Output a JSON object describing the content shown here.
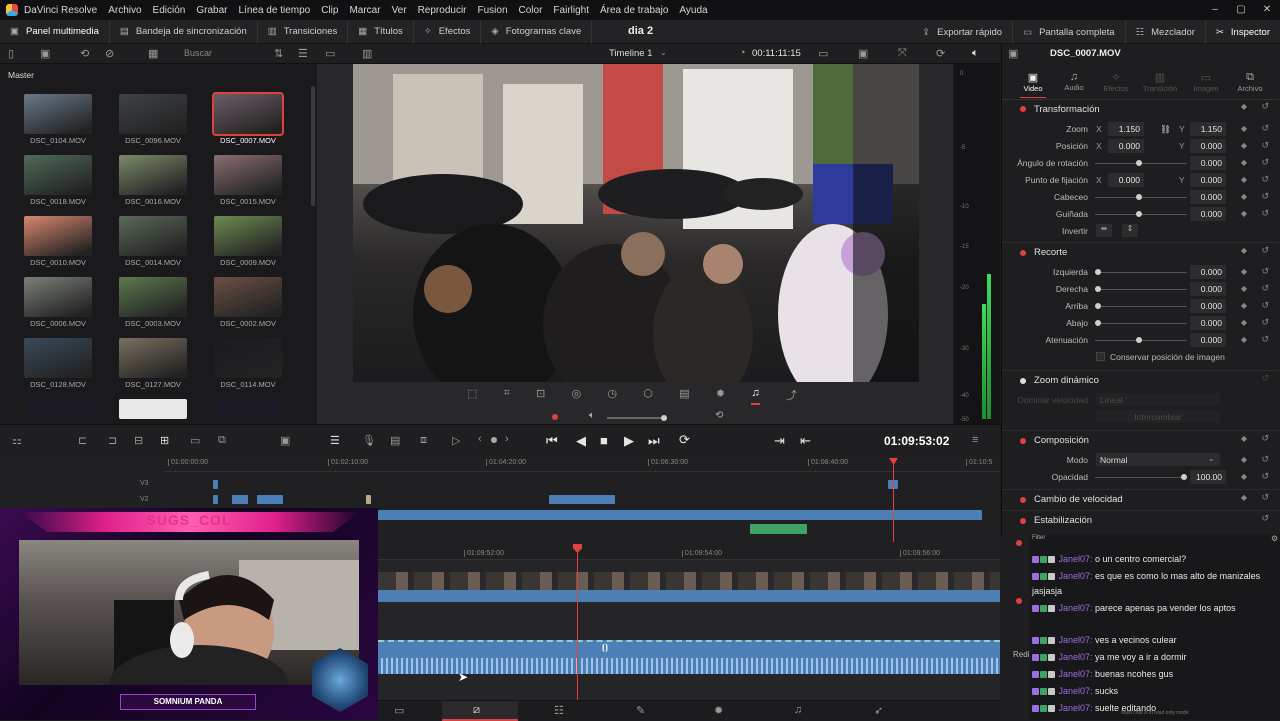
{
  "menu": {
    "app": "DaVinci Resolve",
    "items": [
      "Archivo",
      "Edición",
      "Grabar",
      "Línea de tiempo",
      "Clip",
      "Marcar",
      "Ver",
      "Reproducir",
      "Fusion",
      "Color",
      "Fairlight",
      "Área de trabajo",
      "Ayuda"
    ]
  },
  "toolbar": {
    "panel_media": "Panel multimedia",
    "sync_bin": "Bandeja de sincronización",
    "transitions": "Transiciones",
    "titles": "Títulos",
    "effects": "Efectos",
    "keyframes": "Fotogramas clave",
    "project_name": "dia 2",
    "quick_export": "Exportar rápido",
    "fullscreen": "Pantalla completa",
    "mixer": "Mezclador",
    "inspector": "Inspector"
  },
  "media_pool": {
    "search_placeholder": "Buscar",
    "bin": "Master",
    "clips": [
      "DSC_0104.MOV",
      "DSC_0096.MOV",
      "DSC_0007.MOV",
      "DSC_0018.MOV",
      "DSC_0016.MOV",
      "DSC_0015.MOV",
      "DSC_0010.MOV",
      "DSC_0014.MOV",
      "DSC_0009.MOV",
      "DSC_0006.MOV",
      "DSC_0003.MOV",
      "DSC_0002.MOV",
      "DSC_0128.MOV",
      "DSC_0127.MOV",
      "DSC_0114.MOV"
    ],
    "selected": "DSC_0007.MOV"
  },
  "viewer": {
    "timeline_name": "Timeline 1",
    "timecode": "00:11:11:15",
    "clip_name": "DSC_0007.MOV"
  },
  "meter_ticks": [
    "0",
    "-5",
    "-10",
    "-15",
    "-20",
    "-30",
    "-40",
    "-50"
  ],
  "transport": {
    "timecode": "01:09:53:02"
  },
  "timeline": {
    "ruler_top": [
      "01:00:00:00",
      "01:02:10:00",
      "01:04:20:00",
      "01:06:30:00",
      "01:08:40:00",
      "01:10:5"
    ],
    "tracks": [
      "V3",
      "V2"
    ],
    "ruler_bottom": [
      "01:09:52:00",
      "01:09:54:00",
      "01:09:56:00"
    ],
    "playhead_fraction": 0.32
  },
  "inspector": {
    "tabs": [
      "Video",
      "Audio",
      "Efectos",
      "Transición",
      "Imagen",
      "Archivo"
    ],
    "transform": {
      "title": "Transformación",
      "zoom_label": "Zoom",
      "zoom_x": "1.150",
      "zoom_y": "1.150",
      "position_label": "Posición",
      "pos_x": "0.000",
      "pos_y": "0.000",
      "rotation_label": "Ángulo de rotación",
      "rotation": "0.000",
      "anchor_label": "Punto de fijación",
      "anchor_x": "0.000",
      "anchor_y": "0.000",
      "pitch_label": "Cabeceo",
      "pitch": "0.000",
      "yaw_label": "Guiñada",
      "yaw": "0.000",
      "flip_label": "Invertir"
    },
    "crop": {
      "title": "Recorte",
      "left_label": "Izquierda",
      "left": "0.000",
      "right_label": "Derecha",
      "right": "0.000",
      "top_label": "Arriba",
      "top": "0.000",
      "bottom_label": "Abajo",
      "bottom": "0.000",
      "soft_label": "Atenuación",
      "soft": "0.000",
      "retain": "Conservar posición de imagen"
    },
    "dynamic_zoom": {
      "title": "Zoom dinámico",
      "ease_label": "Dominar velocidad",
      "ease_value": "Lineal",
      "swap": "Intercambiar"
    },
    "composite": {
      "title": "Composición",
      "mode_label": "Modo",
      "mode": "Normal",
      "opacity_label": "Opacidad",
      "opacity": "100.00"
    },
    "speed": {
      "title": "Cambio de velocidad"
    },
    "stabilization": {
      "title": "Estabilización"
    },
    "side_label": "Redi"
  },
  "stream": {
    "channel": "SUGS_COL",
    "overlay": "SOMNIUM PANDA"
  },
  "chat": {
    "filter": "Filter",
    "messages": [
      {
        "user": "Janel07",
        "text": "o un centro comercial?"
      },
      {
        "user": "Janel07",
        "text": "es que es como lo mas alto de manizales jasjasja"
      },
      {
        "user": "Janel07",
        "text": "parece apenas pa vender los aptos"
      },
      {
        "user": "Janel07",
        "text": "ves a vecinos culear"
      },
      {
        "user": "Janel07",
        "text": "ya me voy a ir a dormir"
      },
      {
        "user": "Janel07",
        "text": "buenas ncohes gus"
      },
      {
        "user": "Janel07",
        "text": "sucks"
      },
      {
        "user": "Janel07",
        "text": "suelte editando"
      }
    ],
    "footer": "Multi chat is in read only mode"
  },
  "colors": {
    "accent_red": "#e0403e",
    "clip_blue": "#4c7fb5",
    "audio_green": "#3fa463",
    "chat_user": "#9b6fe0",
    "stream_pink": "#e0208a"
  }
}
